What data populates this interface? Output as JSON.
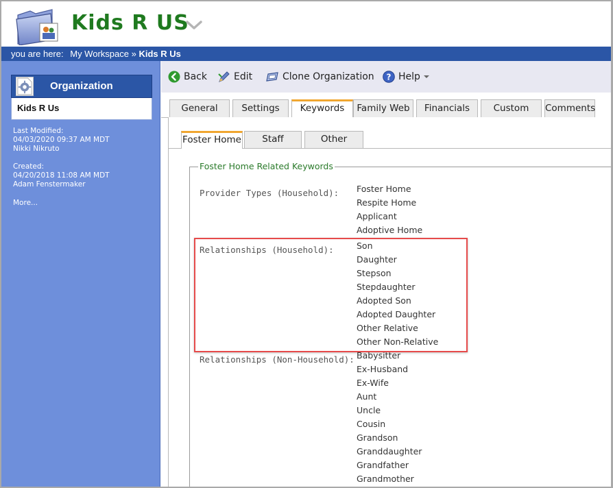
{
  "header": {
    "title": "Kids R US"
  },
  "breadcrumb": {
    "prefix": "you are here:",
    "link": "My Workspace",
    "separator": "»",
    "current": "Kids R Us"
  },
  "sidebar": {
    "heading": "Organization",
    "org_name": "Kids R Us",
    "last_modified_label": "Last Modified:",
    "last_modified_date": "04/03/2020 09:37 AM MDT",
    "last_modified_by": "Nikki Nikruto",
    "created_label": "Created:",
    "created_date": "04/20/2018 11:08 AM MDT",
    "created_by": "Adam Fenstermaker",
    "more": "More..."
  },
  "toolbar": {
    "back": "Back",
    "edit": "Edit",
    "clone": "Clone Organization",
    "help": "Help"
  },
  "tabs": [
    "General",
    "Settings",
    "Keywords",
    "Family Web",
    "Financials",
    "Custom",
    "Comments"
  ],
  "subtabs": [
    "Foster Home",
    "Staff",
    "Other"
  ],
  "fieldset": {
    "legend": "Foster Home Related Keywords",
    "groups": [
      {
        "label": "Provider Types (Household):",
        "items": [
          "Foster Home",
          "Respite Home",
          "Applicant",
          "Adoptive Home"
        ]
      },
      {
        "label": "Relationships (Household):",
        "items": [
          "Son",
          "Daughter",
          "Stepson",
          "Stepdaughter",
          "Adopted Son",
          "Adopted Daughter",
          "Other Relative",
          "Other Non-Relative"
        ]
      },
      {
        "label": "Relationships (Non-Household):",
        "items": [
          "Babysitter",
          "Ex-Husband",
          "Ex-Wife",
          "Aunt",
          "Uncle",
          "Cousin",
          "Grandson",
          "Granddaughter",
          "Grandfather",
          "Grandmother"
        ]
      }
    ]
  },
  "colors": {
    "brand_green": "#1f7a1f",
    "nav_blue": "#2b56a6",
    "sidebar_blue": "#6e8fdb",
    "tab_accent": "#f0a630",
    "highlight_red": "#e64a4a"
  }
}
